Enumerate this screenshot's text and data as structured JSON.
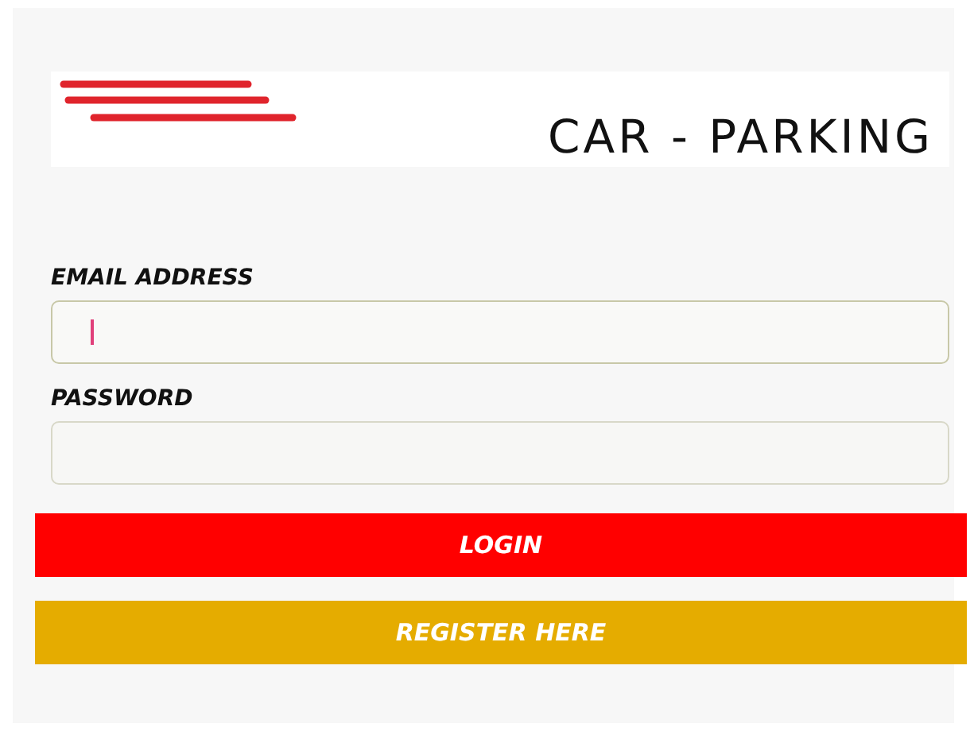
{
  "logo": {
    "title": "CAR - PARKING"
  },
  "fields": [
    {
      "label": "EMAIL ADDRESS",
      "focused": true
    },
    {
      "label": "PASSWORD",
      "focused": false
    }
  ],
  "buttons": [
    {
      "label": "LOGIN",
      "color": "#ff0000"
    },
    {
      "label": "REGISTER HERE",
      "color": "#e5ac00"
    }
  ]
}
